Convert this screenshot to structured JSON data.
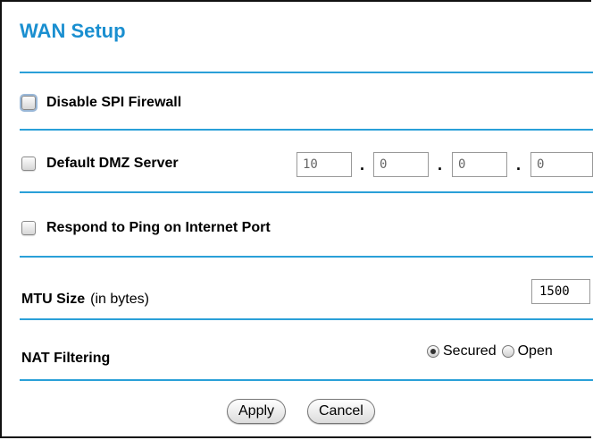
{
  "page": {
    "title": "WAN Setup"
  },
  "options": {
    "disable_spi": {
      "label": "Disable SPI Firewall",
      "checked": false
    },
    "default_dmz": {
      "label": "Default DMZ Server",
      "checked": false,
      "ip": [
        "10",
        "0",
        "0",
        "0"
      ],
      "separator": "."
    },
    "respond_ping": {
      "label": "Respond to Ping on Internet Port",
      "checked": false
    }
  },
  "mtu": {
    "label": "MTU Size",
    "unit": "(in bytes)",
    "value": "1500"
  },
  "nat": {
    "label": "NAT Filtering",
    "options": [
      "Secured",
      "Open"
    ],
    "selected": "Secured"
  },
  "buttons": {
    "apply": "Apply",
    "cancel": "Cancel"
  },
  "colors": {
    "title": "#1a8fd0",
    "rule": "#2aa0d8"
  }
}
